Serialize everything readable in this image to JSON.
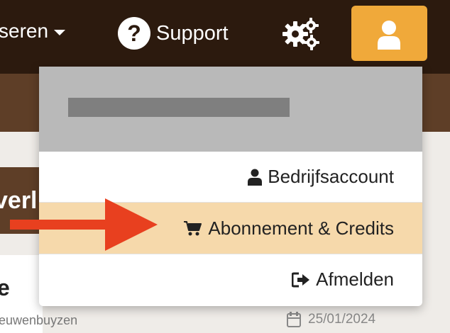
{
  "header": {
    "nav_partial_label": "seren",
    "support_label": "Support",
    "support_icon": "question-circle-icon",
    "settings_icon": "gears-icon",
    "user_icon": "user-icon",
    "accent_color": "#f0a93a",
    "bar_color": "#2c1a0e"
  },
  "background": {
    "tab_partial_text": "verl",
    "card_title_partial": "e",
    "card_subtitle_partial": "ieuwenbuyzen",
    "date": "25/01/2024"
  },
  "dropdown": {
    "items": [
      {
        "label": "Bedrijfsaccount",
        "icon": "user-icon"
      },
      {
        "label": "Abonnement & Credits",
        "icon": "cart-icon",
        "highlighted": true
      },
      {
        "label": "Afmelden",
        "icon": "sign-out-icon"
      }
    ],
    "highlight_color": "#f6d9ab"
  },
  "annotation": {
    "arrow_color": "#e8401f"
  }
}
